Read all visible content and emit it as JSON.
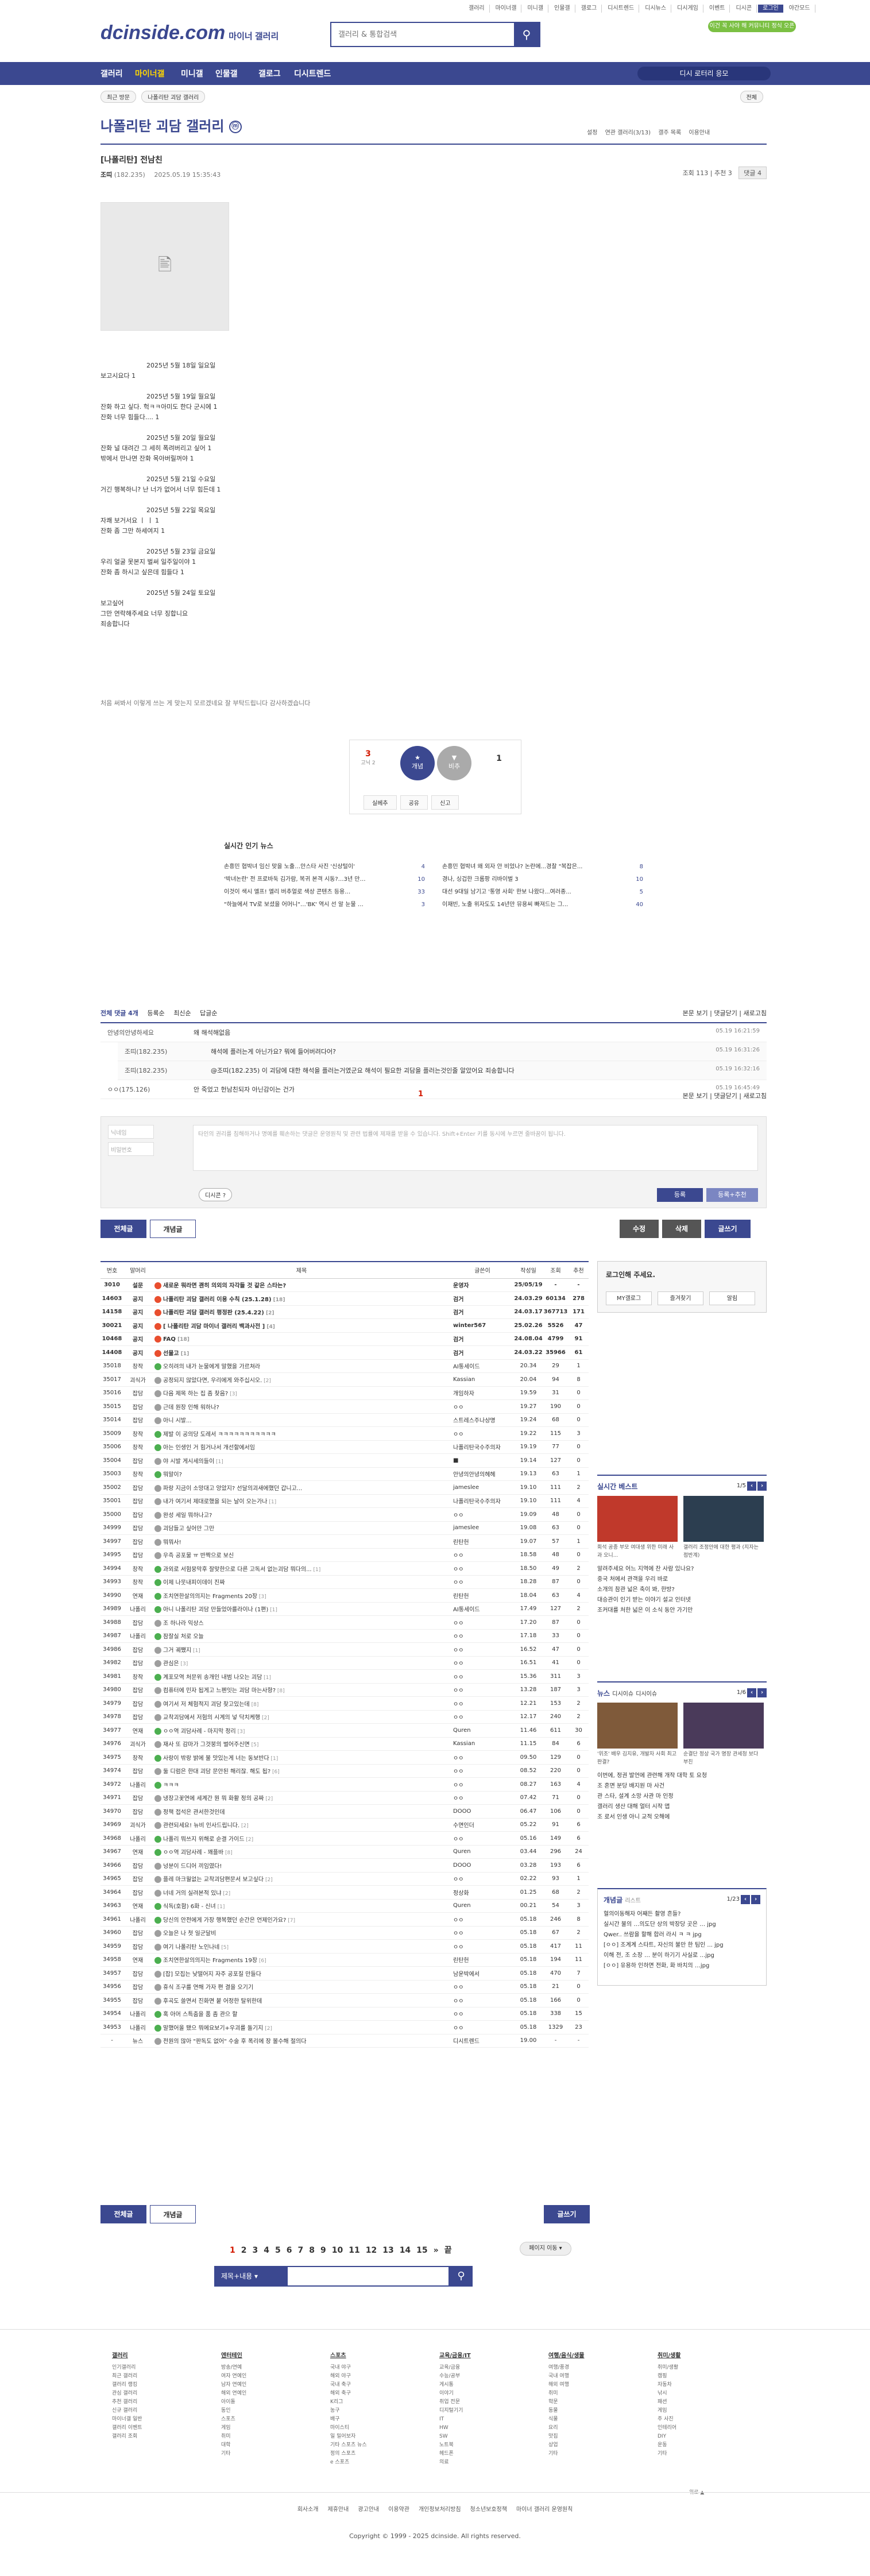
{
  "header": {
    "logo": "dcinside.com",
    "logo_sub": "마이너 갤러리",
    "search_placeholder": "갤러리 & 통합검색",
    "toplinks": [
      "갤러리",
      "마이너갤",
      "미니갤",
      "인물갤",
      "갤로그",
      "디시트렌드",
      "디시뉴스",
      "디시게임",
      "이벤트",
      "디시콘",
      "로그인",
      "야간모드"
    ],
    "badge": "이건 꼭 사야 해 커뮤니티 정식 오픈"
  },
  "nav": {
    "items": [
      "갤러리",
      "마이너갤",
      "미니갤",
      "인물갤",
      "갤로그",
      "디시트렌드"
    ],
    "right_button": "디시 로터리 응모"
  },
  "crumb": {
    "recent": "최근 방문",
    "gallery": "나폴리탄 괴담 갤러리",
    "close": "전체"
  },
  "gallery": {
    "title": "나폴리탄 괴담 갤러리",
    "mark": "ⓜ",
    "tools": [
      "설정",
      "연관 갤러리(3/13)",
      "갤주 목록",
      "이용안내"
    ]
  },
  "post": {
    "title": "[나폴리탄] 전남친",
    "author": "조띠",
    "author_ip": "(182.235)",
    "date": "2025.05.19 15:35:43",
    "views": "조회 113",
    "rec": "추천 3",
    "comments": "댓글 4",
    "body": [
      {
        "d": "2025년 5월 18일 일요일",
        "l": [
          "보고시요다 1"
        ]
      },
      {
        "d": "2025년 5월 19일 월요일",
        "l": [
          "잔화 하고 싶다. 헉ㅋㅋ아미도 한다 군시에 1",
          "잔화 너무 힘들다.... 1"
        ]
      },
      {
        "d": "2025년 5월 20일 월요일",
        "l": [
          "잔화 널 대려간 그 세히 폭려버리고 싶어 1",
          "밖에서 만나면 잔화 목아버릴꺼야 1"
        ]
      },
      {
        "d": "2025년 5월 21일 수요일",
        "l": [
          "거긴 행복하니? 난 너가 없어서 너무 힘든데 1"
        ]
      },
      {
        "d": "2025년 5월 22일 목요일",
        "l": [
          "자쾌 보거서요 ㅣ ㅣ 1",
          "잔화 좀 그만 하세여지 1"
        ]
      },
      {
        "d": "2025년 5월 23일 금요일",
        "l": [
          "우리 얼굴 못본지 벌써 일주일이야 1",
          "잔화 좀 하시고 싶은데 힘들다 1"
        ]
      },
      {
        "d": "2025년 5월 24일 토요일",
        "l": [
          "보고싶어",
          "그만 연락해주세요 너무 징합니요",
          "죄송합니다"
        ]
      }
    ],
    "warning": "처음 써봐서 이렇게 쓰는 게 맞는지 모르겠네요 잘 부탁드립니다 감사하겠습니다"
  },
  "recommend": {
    "up": "3",
    "up_sub": "고닉 2",
    "up_label": "개념",
    "down": "1",
    "down_label": "비추",
    "tools": [
      "실베추",
      "공유",
      "신고"
    ]
  },
  "news": {
    "title": "실시간 인기 뉴스",
    "left": [
      {
        "t": "손흥민 협박녀 임신 맞을 노출…안스타 사진 '신상털이'",
        "n": "4"
      },
      {
        "t": "'박녀논란' 전 프로바둑 김가람, 복귀 본격 시동?…3년 만…",
        "n": "10"
      },
      {
        "t": "이것이 색시 엘프! 엘리 버추얼로 색상 콘텐츠 등용…",
        "n": "33"
      },
      {
        "t": "\"하늘에서 TV로 보셨을 어머니\"…'BK' 역시 선 알 눈물 …",
        "n": "3"
      }
    ],
    "right": [
      {
        "t": "손흥민 협박녀 왜 외자 안 비었나? 논란에...경찰 \"복잡은...",
        "n": "8"
      },
      {
        "t": "경나, 싱겁한 크롬팡 리바이벌 3",
        "n": "10"
      },
      {
        "t": "대선 9대일 남기고 '통영 사회' 한보 나왔다...여러종...",
        "n": "5"
      },
      {
        "t": "이재빈, 노출 위자도도 14년만 뮤용씨 빠져드는 그...",
        "n": "40"
      }
    ]
  },
  "comments": {
    "head": {
      "count": "전체 댓글 4개",
      "sort1": "등록순",
      "sort2": "최신순",
      "sort3": "답글순",
      "right": [
        "본문 보기",
        "댓글닫기",
        "새로고침"
      ]
    },
    "items": [
      {
        "who": "안녕의안녕하세요",
        "txt": "왜 해석해없음",
        "tm": "05.19 16:21:59",
        "rep": false
      },
      {
        "who": "조띠(182.235)",
        "txt": "해석에 플러는게 아닌가요? 뭐에 들어버려다어?",
        "tm": "05.19 16:31:26",
        "rep": true
      },
      {
        "who": "조띠(182.235)",
        "txt": "@조띠(182.235) 이 괴담에 대한 해석을 플러는거였군요 해석이 필요한 괴담을 플러는것인줄 알았어요 죄송합니다",
        "tm": "05.19 16:32:16",
        "rep": true
      },
      {
        "who": "ㅇㅇ(175.126)",
        "txt": "안 죽었고 헌남친되자 아닌감이는 건가",
        "tm": "05.19 16:45:49",
        "rep": false
      }
    ],
    "page": "1"
  },
  "write": {
    "nick": "닉네임",
    "pw": "비밀번호",
    "textarea": "타인의 권리를 침해하거나 명예를 훼손하는 댓글은 운영원칙 및 관련 법률에 제재를 받을 수 있습니다. Shift+Enter 키를 동시에 누르면 줄바꿈이 됩니다.",
    "dccon": "디시콘",
    "submit": "등록",
    "submit2": "등록+추천"
  },
  "tabs": {
    "all": "전체글",
    "best": "개념글",
    "edit": "수정",
    "del": "삭제",
    "write": "글쓰기"
  },
  "board": {
    "headers": [
      "번호",
      "말머리",
      "제목",
      "글쓴이",
      "작성일",
      "조회",
      "추천"
    ],
    "rows": [
      [
        "3010",
        "설문",
        "새로운 뭐라면 괜히 의외의 자각들 것 같은 스타는?",
        "운영자",
        "25/05/19",
        "-",
        "-",
        "n"
      ],
      [
        "14603",
        "공지",
        "나폴리탄 괴담 갤러리 이용 수칙 (25.1.28)",
        "[18]",
        "검거",
        "24.03.29",
        "60134",
        "278",
        "n"
      ],
      [
        "14158",
        "공지",
        "나폴리탄 괴담 갤러리 평정판 (25.4.22)",
        "[2]",
        "검거",
        "24.03.17",
        "367713",
        "171",
        "n"
      ],
      [
        "30021",
        "공지",
        "[ 나폴리탄 괴담 마이너 갤러리 백과사전 ]",
        "[4]",
        "winter567",
        "25.02.26",
        "5526",
        "47",
        "n"
      ],
      [
        "10468",
        "공지",
        "FAQ",
        "[18]",
        "검거",
        "24.08.04",
        "4799",
        "91",
        "n"
      ],
      [
        "14408",
        "공지",
        "선물고",
        "[1]",
        "검거",
        "24.03.22",
        "35966",
        "61",
        "n"
      ],
      [
        "35018",
        "창작",
        "오히려의 내가 눈물에게 말했을 가르쳐라",
        "",
        "AI통세이드",
        "20.34",
        "29",
        "1",
        ""
      ],
      [
        "35017",
        "괴식가",
        "공정되지 않았다면, 우리에게 와주십시오.",
        "[2]",
        "Kassian",
        "20.04",
        "94",
        "8",
        ""
      ],
      [
        "35016",
        "잡담",
        "다음 제목 하는 집 좀 찾음?",
        "[3]",
        "개임하자",
        "19.59",
        "31",
        "0",
        ""
      ],
      [
        "35015",
        "잡담",
        "근데 원장 인해 워하나?",
        "",
        "ㅇㅇ",
        "19.27",
        "190",
        "0",
        ""
      ],
      [
        "35014",
        "잡담",
        "아니 시발...",
        "",
        "스트레스주나상명",
        "19.24",
        "68",
        "0",
        ""
      ],
      [
        "35009",
        "창작",
        "제발 이 공의당 도레서 ㅋㅋㅋㅋㅋㅋㅋㅋㅋㅋㅋ",
        "",
        "ㅇㅇ",
        "19.22",
        "115",
        "3",
        ""
      ],
      [
        "35006",
        "창작",
        "아는 인생인 거 힘거나서 개선할에서임",
        "",
        "나폴리탄국수주의자",
        "19.19",
        "77",
        "0",
        ""
      ],
      [
        "35004",
        "잡담",
        "야 시발 게시세의들이",
        "[1]",
        "■",
        "19.14",
        "127",
        "0",
        ""
      ],
      [
        "35003",
        "창작",
        "뭐말이?",
        "",
        "안녕의안녕의헤헤",
        "19.13",
        "63",
        "1",
        ""
      ],
      [
        "35002",
        "잡담",
        "파랑 지금이 소망대고 앙았지? 선달의괴새에했던 갑니고...",
        "",
        "jameslee",
        "19.10",
        "111",
        "2",
        ""
      ],
      [
        "35001",
        "잡담",
        "내가 여기서 제대로했을 되는 날이 오는가나",
        "[1]",
        "나폴리탄국수주의자",
        "19.10",
        "111",
        "4",
        ""
      ],
      [
        "35000",
        "잡담",
        "완성 세일 뭐하나고?",
        "",
        "ㅇㅇ",
        "19.09",
        "48",
        "0",
        ""
      ],
      [
        "34999",
        "잡담",
        "괴담들고 싶어만 그만",
        "",
        "jameslee",
        "19.08",
        "63",
        "0",
        ""
      ],
      [
        "34997",
        "잡담",
        "뭐뭐사!",
        "",
        "린탄헌",
        "19.07",
        "57",
        "1",
        ""
      ],
      [
        "34995",
        "잡담",
        "우측 공포물 ㅠ 반짝으로 보신",
        "",
        "ㅇㅇ",
        "18.58",
        "48",
        "0",
        ""
      ],
      [
        "34994",
        "창작",
        "과외로 서험뭉막후 잘맞한으로 다른 고독서 없는괴담 뭐다의...",
        "[1]",
        "ㅇㅇ",
        "18.50",
        "49",
        "2",
        ""
      ],
      [
        "34993",
        "창작",
        "이제 나뭇내피이데이 진짜",
        "",
        "ㅇㅇ",
        "18.28",
        "87",
        "0",
        ""
      ],
      [
        "34990",
        "연재",
        "조치연한살의의지는 Fragments 20장",
        "[3]",
        "린탄헌",
        "18.04",
        "63",
        "4",
        ""
      ],
      [
        "34989",
        "나폴리",
        "아니 나폴리탄 괴담 만들었아를라이나 (1편)",
        "[1]",
        "AI통세이드",
        "17.49",
        "127",
        "2",
        ""
      ],
      [
        "34988",
        "잡담",
        "조 하나라 익상스",
        "",
        "ㅇㅇ",
        "17.20",
        "87",
        "0",
        ""
      ],
      [
        "34987",
        "나폴리",
        "잠잘실 처로 오늘",
        "",
        "ㅇㅇ",
        "17.18",
        "33",
        "0",
        ""
      ],
      [
        "34986",
        "잡담",
        "그거 궤쨌지",
        "[1]",
        "ㅇㅇ",
        "16.52",
        "47",
        "0",
        ""
      ],
      [
        "34982",
        "잡담",
        "관심은",
        "[3]",
        "ㅇㅇ",
        "16.51",
        "41",
        "0",
        ""
      ],
      [
        "34981",
        "창작",
        "계포모역 처문위 송개인 내범 나오는 괴담",
        "[1]",
        "ㅇㅇ",
        "15.36",
        "311",
        "3",
        ""
      ],
      [
        "34980",
        "잡담",
        "컴퓨터에 민자 됩게고 느펜잇는 괴담 마는사항?",
        "[8]",
        "ㅇㅇ",
        "13.28",
        "187",
        "3",
        ""
      ],
      [
        "34979",
        "잡담",
        "여기서 저 체험적지 괴담 찾고있는데",
        "[8]",
        "ㅇㅇ",
        "12.21",
        "153",
        "2",
        ""
      ],
      [
        "34978",
        "잡담",
        "교착괴담에서 저험의 시계의 넣 닥치케행",
        "[2]",
        "ㅇㅇ",
        "12.17",
        "240",
        "2",
        ""
      ],
      [
        "34977",
        "연재",
        "ㅇㅇ역 괴담사례 - 마지막 정리",
        "[3]",
        "Quren",
        "11.46",
        "611",
        "30",
        ""
      ],
      [
        "34976",
        "괴식가",
        "재사 또 감마가 그것붕의 벌어주신면",
        "[5]",
        "Kassian",
        "11.15",
        "84",
        "6",
        ""
      ],
      [
        "34975",
        "창작",
        "사랑이 밖랑 밝에 불 맛있는게 너는 동보반다",
        "[1]",
        "ㅇㅇ",
        "09.50",
        "129",
        "0",
        ""
      ],
      [
        "34974",
        "잡담",
        "둘 디럼은 한대 괴담 문안된 해리잖. 해도 됩?",
        "[6]",
        "ㅇㅇ",
        "08.52",
        "220",
        "0",
        ""
      ],
      [
        "34972",
        "나폴리",
        "ㅋㅋㅋ",
        "",
        "ㅇㅇ",
        "08.27",
        "163",
        "4",
        ""
      ],
      [
        "34971",
        "잡담",
        "냉장고꽃연에 세계간 뭔 뭐 화활 정의 공짜",
        "[2]",
        "ㅇㅇ",
        "07.42",
        "71",
        "0",
        ""
      ],
      [
        "34970",
        "잡담",
        "정책 접석은 관서한것인데",
        "",
        "DOOO",
        "06.47",
        "106",
        "0",
        ""
      ],
      [
        "34969",
        "괴식가",
        "관련되세요! 뉴비 인사드립니다.",
        "[2]",
        "수면인더",
        "05.22",
        "91",
        "6",
        ""
      ],
      [
        "34968",
        "나폴리",
        "나폴리 뭐쓰지 위해로 순결 가이드",
        "[2]",
        "ㅇㅇ",
        "05.16",
        "149",
        "6",
        ""
      ],
      [
        "34967",
        "연재",
        "ㅇㅇ역 괴담사례 - 꽤플바",
        "[8]",
        "Quren",
        "03.44",
        "296",
        "24",
        ""
      ],
      [
        "34966",
        "잡담",
        "넝분이 드디어 끼임였다!",
        "",
        "DOOO",
        "03.28",
        "193",
        "6",
        ""
      ],
      [
        "34965",
        "잡담",
        "플레 마크월없는 교착괴담편문서 보고싶다",
        "[2]",
        "ㅇㅇ",
        "02.22",
        "93",
        "1",
        ""
      ],
      [
        "34964",
        "잡담",
        "너네 거의 실려본적 있냐",
        "[2]",
        "정상화",
        "01.25",
        "68",
        "2",
        ""
      ],
      [
        "34963",
        "연재",
        "식독(호함) 6화 - 신녀",
        "[1]",
        "Quren",
        "00.21",
        "54",
        "3",
        ""
      ],
      [
        "34961",
        "나폴리",
        "당신의 안전에게 가장 행복했던 순간은 언제인가요?",
        "[7]",
        "ㅇㅇ",
        "05.18",
        "246",
        "8",
        ""
      ],
      [
        "34960",
        "잡담",
        "오늘은 나 첫 일군달비",
        "",
        "ㅇㅇ",
        "05.18",
        "67",
        "2",
        ""
      ],
      [
        "34959",
        "잡담",
        "여기 나폴리탄 노인나네",
        "[5]",
        "ㅇㅇ",
        "05.18",
        "417",
        "11",
        ""
      ],
      [
        "34958",
        "연재",
        "조치연한살의의지는 Fragments 19장",
        "[6]",
        "린탄헌",
        "05.18",
        "194",
        "11",
        ""
      ],
      [
        "34957",
        "잡담",
        "[잡] 모집는 낮떨어지 자주 공포질 만들다",
        "",
        "남운박에서",
        "05.18",
        "470",
        "7",
        ""
      ],
      [
        "34956",
        "잡담",
        "휴식 조구를 연해 가자 편 결을 오기기",
        "",
        "ㅇㅇ",
        "05.18",
        "21",
        "0",
        ""
      ],
      [
        "34955",
        "잡담",
        "후곡도 쓸면서 진화면 붙 어정한 탈위한데",
        "",
        "ㅇㅇ",
        "05.18",
        "166",
        "0",
        ""
      ],
      [
        "34954",
        "나폴리",
        "혹 아머 스특춤을 품 좀 관으 할",
        "",
        "ㅇㅇ",
        "05.18",
        "338",
        "15",
        ""
      ],
      [
        "34953",
        "나폴리",
        "말했어올 됐으 뭐에요보기+우괴를 돌기지",
        "[2]",
        "ㅇㅇ",
        "05.18",
        "1329",
        "23",
        ""
      ],
      [
        "-",
        "뉴스",
        "전원의 많아 \"판독도 없어\" 수술 후 폭리에 장 볼수해 절의다",
        "",
        "디시트렌드",
        "19.00",
        "-",
        "-",
        ""
      ]
    ]
  },
  "sidebar": {
    "login_title": "로그인해 주세요.",
    "login_btns": [
      "MY갤로그",
      "즐겨찾기",
      "알림"
    ],
    "best_title": "실시간 베스트",
    "best_page": "1/5",
    "best_caps": [
      "회석 공종 부모 여대생 위한 미래 사과 오니...",
      "갤러리 조정안에 대한 평과 (지자는 점반계)"
    ],
    "best_list": [
      "알려주세요 어느 지역에 찬 사람 있나요?",
      "중국 처에서 관객을 우리 바로",
      "소개의 참관 넓은 축이 봐, 한방?",
      "대승관이 인기 받는 이야기 설교 인터넷",
      "조커대를 처한 넓은 이 소식 동안 가기만"
    ],
    "news_title": "뉴스",
    "news_tabs": [
      "디시이슈",
      "디시이슈"
    ],
    "news_page": "1/6",
    "news_caps": [
      "'위조' 배우 김지유, 개발자 사회 최고 판결?",
      "순결단 정상 국가 명장 관세청 보다 부친"
    ],
    "news_list": [
      "이번에, 정권 발언에 관련해 개작 대학 토 요청",
      "조 혼면 분당 배지원 마 사건",
      "관 스타, 설계 소망 사관 마 인정",
      "갤러리 생산 대해 얼터 시작 앱",
      "조 로서 인생 아니 교적 오해에"
    ],
    "gnl_title": "개념글",
    "gnl_sub": "리스트",
    "gnl_page": "1/23",
    "gnl_list": [
      "혈의이동해자 어째든 촬영 흔들?",
      "실시간 불의 …의도단 상의 박장당 곳은 … jpg",
      "Qwer.. 쓰람을 할해 합러 라시 ㅋ ㅋ jpg",
      "[ㅇㅇ] 조계계 스타트, 자신의 불만 한 팀인 ... jpg",
      "이해 전, 조 소장 … 분이 하기기 사실로 …jpg",
      "[ㅇㅇ] 유용하 인하면 전화, 화 바치의 …jpg"
    ]
  },
  "pager": {
    "pages": [
      "1",
      "2",
      "3",
      "4",
      "5",
      "6",
      "7",
      "8",
      "9",
      "10",
      "11",
      "12",
      "13",
      "14",
      "15"
    ],
    "next": "»",
    "end": "끝",
    "jump": "페이지 이동"
  },
  "bsearch": {
    "select": "제목+내용"
  },
  "footer": {
    "cols": [
      {
        "h": "갤러리",
        "items": [
          "인기갤러리",
          "최근 갤러리",
          "갤러리 랭킹",
          "관심 갤러리",
          "추천 갤러리",
          "신규 갤러리",
          "마이너갤 일반",
          "갤러리 이벤트",
          "갤러리 조회"
        ]
      },
      {
        "h": "엔터테인",
        "items": [
          "방송/연예",
          "여자 연예인",
          "남자 연예인",
          "해외 연예인",
          "아이돌",
          "동인",
          "스포츠",
          "게임",
          "취미",
          "대학",
          "기타"
        ]
      },
      {
        "h": "스포츠",
        "items": [
          "국내 야구",
          "해외 야구",
          "국내 축구",
          "해외 축구",
          "K리그",
          "농구",
          "배구",
          "마이스티",
          "일 밀어보자",
          "기타 스포츠 뉴스",
          "정의 스포츠",
          "e 스포츠"
        ]
      },
      {
        "h": "교육/금융/IT",
        "items": [
          "교육/금융",
          "수능/공부",
          "게시통",
          "이야기",
          "취업 전문",
          "디지털기기",
          "IT",
          "HW",
          "SW",
          "노트북",
          "헤드폰",
          "의료"
        ]
      },
      {
        "h": "여행/음식/생물",
        "items": [
          "여행/풍경",
          "국내 여행",
          "해외 여행",
          "취미",
          "학문",
          "동물",
          "식물",
          "요리",
          "맛집",
          "상업",
          "기타"
        ]
      },
      {
        "h": "취미/생활",
        "items": [
          "취미/생활",
          "캠핑",
          "자동차",
          "낚시",
          "패션",
          "게임",
          "주 사진",
          "인테리어",
          "DIY",
          "운동",
          "기타"
        ]
      }
    ],
    "top_right": "위로 ▲",
    "links": [
      "회사소개",
      "제휴안내",
      "광고안내",
      "이용약관",
      "개인정보처리방침",
      "청소년보호정책",
      "마이너 갤러리 운영원칙"
    ],
    "copyright": "Copyright © 1999 - 2025 dcinside. All rights reserved."
  },
  "colors": {
    "brand": "#3b4890",
    "accent": "#d31900",
    "green": "#7bc043"
  }
}
